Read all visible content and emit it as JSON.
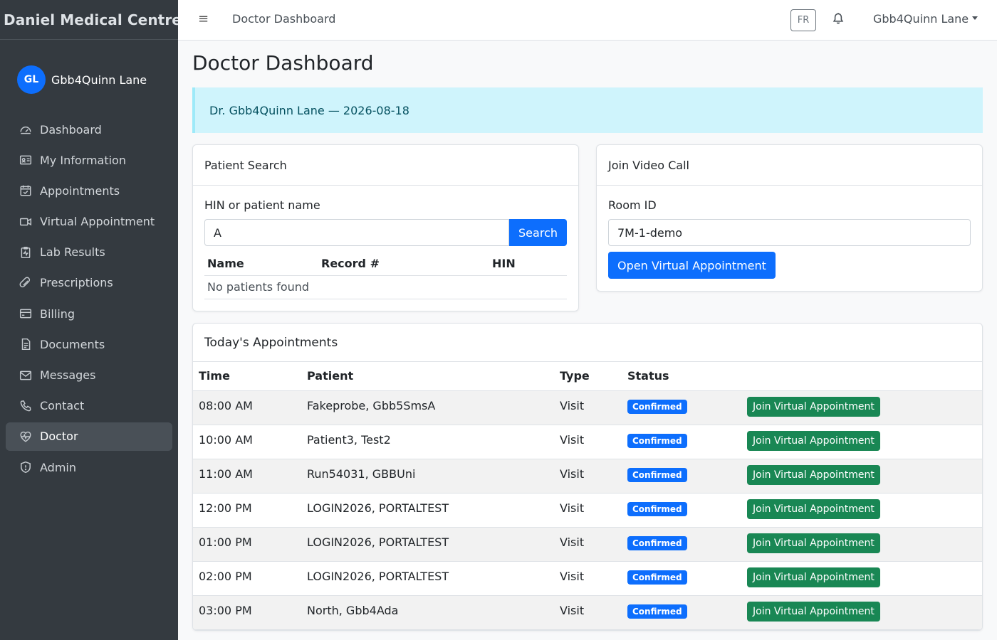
{
  "brand": "Daniel Medical Centre",
  "user": {
    "initials": "GL",
    "name": "Gbb4Quinn Lane"
  },
  "nav": [
    {
      "label": "Dashboard",
      "icon": "dashboard-icon"
    },
    {
      "label": "My Information",
      "icon": "id-card-icon"
    },
    {
      "label": "Appointments",
      "icon": "calendar-check-icon"
    },
    {
      "label": "Virtual Appointment",
      "icon": "video-camera-icon"
    },
    {
      "label": "Lab Results",
      "icon": "clipboard-pulse-icon"
    },
    {
      "label": "Prescriptions",
      "icon": "capsule-icon"
    },
    {
      "label": "Billing",
      "icon": "credit-card-icon"
    },
    {
      "label": "Documents",
      "icon": "document-icon"
    },
    {
      "label": "Messages",
      "icon": "envelope-icon"
    },
    {
      "label": "Contact",
      "icon": "telephone-icon"
    },
    {
      "label": "Doctor",
      "icon": "heart-pulse-icon",
      "active": true
    },
    {
      "label": "Admin",
      "icon": "shield-icon"
    }
  ],
  "topbar": {
    "title": "Doctor Dashboard",
    "lang": "FR",
    "user_menu": "Gbb4Quinn Lane"
  },
  "page": {
    "title": "Doctor Dashboard",
    "alert": "Dr. Gbb4Quinn Lane — 2026-08-18"
  },
  "patient_search": {
    "header": "Patient Search",
    "label": "HIN or patient name",
    "value": "A",
    "button": "Search",
    "columns": [
      "Name",
      "Record #",
      "HIN"
    ],
    "empty": "No patients found"
  },
  "video_call": {
    "header": "Join Video Call",
    "label": "Room ID",
    "value": "7M-1-demo",
    "button": "Open Virtual Appointment"
  },
  "appointments": {
    "header": "Today's Appointments",
    "columns": [
      "Time",
      "Patient",
      "Type",
      "Status"
    ],
    "join_label": "Join Virtual Appointment",
    "rows": [
      {
        "time": "08:00 AM",
        "patient": "Fakeprobe, Gbb5SmsA",
        "type": "Visit",
        "status": "Confirmed"
      },
      {
        "time": "10:00 AM",
        "patient": "Patient3, Test2",
        "type": "Visit",
        "status": "Confirmed"
      },
      {
        "time": "11:00 AM",
        "patient": "Run54031, GBBUni",
        "type": "Visit",
        "status": "Confirmed"
      },
      {
        "time": "12:00 PM",
        "patient": "LOGIN2026, PORTALTEST",
        "type": "Visit",
        "status": "Confirmed"
      },
      {
        "time": "01:00 PM",
        "patient": "LOGIN2026, PORTALTEST",
        "type": "Visit",
        "status": "Confirmed"
      },
      {
        "time": "02:00 PM",
        "patient": "LOGIN2026, PORTALTEST",
        "type": "Visit",
        "status": "Confirmed"
      },
      {
        "time": "03:00 PM",
        "patient": "North, Gbb4Ada",
        "type": "Visit",
        "status": "Confirmed"
      }
    ]
  },
  "colors": {
    "sidebar": "#343a40",
    "primary": "#0d6efd",
    "success": "#198754",
    "alert_bg": "#cff4fc"
  }
}
